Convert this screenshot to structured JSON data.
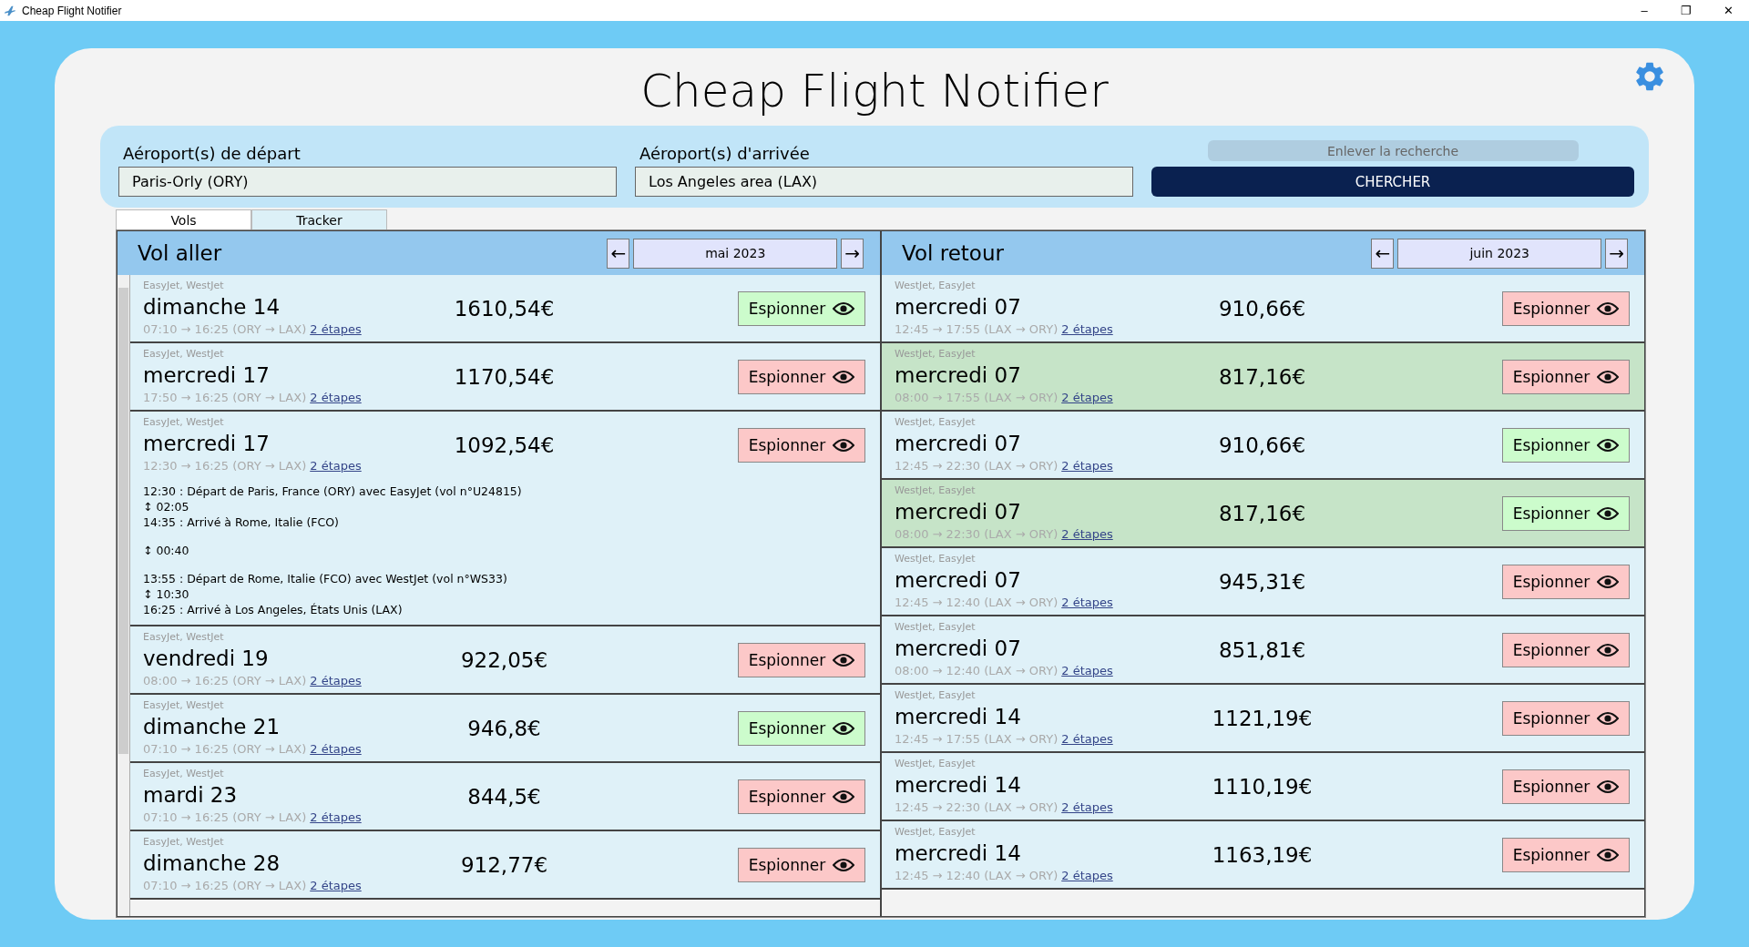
{
  "window": {
    "title": "Cheap Flight Notifier",
    "controls": [
      "–",
      "❐",
      "✕"
    ]
  },
  "app_title": "Cheap Flight Notifier",
  "search": {
    "departure": {
      "label": "Aéroport(s) de départ",
      "value": "Paris-Orly (ORY)"
    },
    "arrival": {
      "label": "Aéroport(s) d'arrivée",
      "value": "Los Angeles area (LAX)"
    },
    "clear_button": {
      "label": "Enlever la recherche",
      "disabled": true
    },
    "search_button": "CHERCHER"
  },
  "tabs": [
    {
      "label": "Vols",
      "selected": true
    },
    {
      "label": "Tracker",
      "selected": false
    }
  ],
  "columns": [
    {
      "title": "Vol aller",
      "prev": "←",
      "month": "mai 2023",
      "next": "→",
      "scrollable": true,
      "flights": [
        {
          "airlines": "EasyJet, WestJet",
          "day": "dimanche 14",
          "times": "07:10 → 16:25 (ORY → LAX)",
          "stops": "2 étapes",
          "price": "1610,54€",
          "spy_label": "Espionner",
          "spying": true,
          "highlighted": false
        },
        {
          "airlines": "EasyJet, WestJet",
          "day": "mercredi 17",
          "times": "17:50 → 16:25 (ORY → LAX)",
          "stops": "2 étapes",
          "price": "1170,54€",
          "spy_label": "Espionner",
          "spying": false,
          "highlighted": false
        },
        {
          "airlines": "EasyJet, WestJet",
          "day": "mercredi 17",
          "times": "12:30 → 16:25 (ORY → LAX)",
          "stops": "2 étapes",
          "price": "1092,54€",
          "spy_label": "Espionner",
          "spying": false,
          "highlighted": false,
          "details": [
            [
              "12:30 : Départ de Paris, France (ORY) avec EasyJet (vol n°U24815)",
              "↕ 02:05",
              "14:35 : Arrivé à Rome, Italie (FCO)"
            ],
            [
              "↕ 00:40"
            ],
            [
              "13:55 : Départ de Rome, Italie (FCO) avec WestJet (vol n°WS33)",
              "↕ 10:30",
              "16:25 : Arrivé à Los Angeles, États Unis (LAX)"
            ]
          ]
        },
        {
          "airlines": "EasyJet, WestJet",
          "day": "vendredi 19",
          "times": "08:00 → 16:25 (ORY → LAX)",
          "stops": "2 étapes",
          "price": "922,05€",
          "spy_label": "Espionner",
          "spying": false,
          "highlighted": false
        },
        {
          "airlines": "EasyJet, WestJet",
          "day": "dimanche 21",
          "times": "07:10 → 16:25 (ORY → LAX)",
          "stops": "2 étapes",
          "price": "946,8€",
          "spy_label": "Espionner",
          "spying": true,
          "highlighted": false
        },
        {
          "airlines": "EasyJet, WestJet",
          "day": "mardi 23",
          "times": "07:10 → 16:25 (ORY → LAX)",
          "stops": "2 étapes",
          "price": "844,5€",
          "spy_label": "Espionner",
          "spying": false,
          "highlighted": false
        },
        {
          "airlines": "EasyJet, WestJet",
          "day": "dimanche 28",
          "times": "07:10 → 16:25 (ORY → LAX)",
          "stops": "2 étapes",
          "price": "912,77€",
          "spy_label": "Espionner",
          "spying": false,
          "highlighted": false
        }
      ]
    },
    {
      "title": "Vol retour",
      "prev": "←",
      "month": "juin 2023",
      "next": "→",
      "scrollable": false,
      "flights": [
        {
          "airlines": "WestJet, EasyJet",
          "day": "mercredi 07",
          "times": "12:45 → 17:55 (LAX → ORY)",
          "stops": "2 étapes",
          "price": "910,66€",
          "spy_label": "Espionner",
          "spying": false,
          "highlighted": false
        },
        {
          "airlines": "WestJet, EasyJet",
          "day": "mercredi 07",
          "times": "08:00 → 17:55 (LAX → ORY)",
          "stops": "2 étapes",
          "price": "817,16€",
          "spy_label": "Espionner",
          "spying": false,
          "highlighted": true
        },
        {
          "airlines": "WestJet, EasyJet",
          "day": "mercredi 07",
          "times": "12:45 → 22:30 (LAX → ORY)",
          "stops": "2 étapes",
          "price": "910,66€",
          "spy_label": "Espionner",
          "spying": true,
          "highlighted": false
        },
        {
          "airlines": "WestJet, EasyJet",
          "day": "mercredi 07",
          "times": "08:00 → 22:30 (LAX → ORY)",
          "stops": "2 étapes",
          "price": "817,16€",
          "spy_label": "Espionner",
          "spying": true,
          "highlighted": true
        },
        {
          "airlines": "WestJet, EasyJet",
          "day": "mercredi 07",
          "times": "12:45 → 12:40 (LAX → ORY)",
          "stops": "2 étapes",
          "price": "945,31€",
          "spy_label": "Espionner",
          "spying": false,
          "highlighted": false
        },
        {
          "airlines": "WestJet, EasyJet",
          "day": "mercredi 07",
          "times": "08:00 → 12:40 (LAX → ORY)",
          "stops": "2 étapes",
          "price": "851,81€",
          "spy_label": "Espionner",
          "spying": false,
          "highlighted": false
        },
        {
          "airlines": "WestJet, EasyJet",
          "day": "mercredi 14",
          "times": "12:45 → 17:55 (LAX → ORY)",
          "stops": "2 étapes",
          "price": "1121,19€",
          "spy_label": "Espionner",
          "spying": false,
          "highlighted": false
        },
        {
          "airlines": "WestJet, EasyJet",
          "day": "mercredi 14",
          "times": "12:45 → 22:30 (LAX → ORY)",
          "stops": "2 étapes",
          "price": "1110,19€",
          "spy_label": "Espionner",
          "spying": false,
          "highlighted": false
        },
        {
          "airlines": "WestJet, EasyJet",
          "day": "mercredi 14",
          "times": "12:45 → 12:40 (LAX → ORY)",
          "stops": "2 étapes",
          "price": "1163,19€",
          "spy_label": "Espionner",
          "spying": false,
          "highlighted": false
        }
      ]
    }
  ]
}
